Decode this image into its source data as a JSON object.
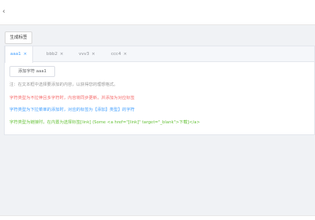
{
  "topbar": {
    "icon": "chevron-left-icon",
    "glyph": "‹"
  },
  "toolbar": {
    "generate_label": "生成标签"
  },
  "tabs": [
    {
      "label": "aaa1",
      "close": "×",
      "active": true
    },
    {
      "label": "bbb2",
      "close": "×",
      "active": false
    },
    {
      "label": "vvv3",
      "close": "×",
      "active": false
    },
    {
      "label": "ccc4",
      "close": "×",
      "active": false
    }
  ],
  "content": {
    "add_button_label": "添加字符 aaa1",
    "hint": "注：在文本框中选择要添加的内容，以获得您的理想格式。",
    "red_line": "字符类型为不拉伸且多字符时，内容将同步更新，并添加为对应标签",
    "blue_line": "字符类型为下拉菜单的添加时，对应的标签为【添加】类型】的字符",
    "green_line": "字符类型为链接时，在内置为选择标签[link] (Some <a href=\"[link]\" target=\"_blank\">下载]</a>"
  },
  "colors": {
    "accent": "#409eff",
    "danger": "#f56c6c",
    "success": "#67c23a",
    "muted": "#999999"
  }
}
